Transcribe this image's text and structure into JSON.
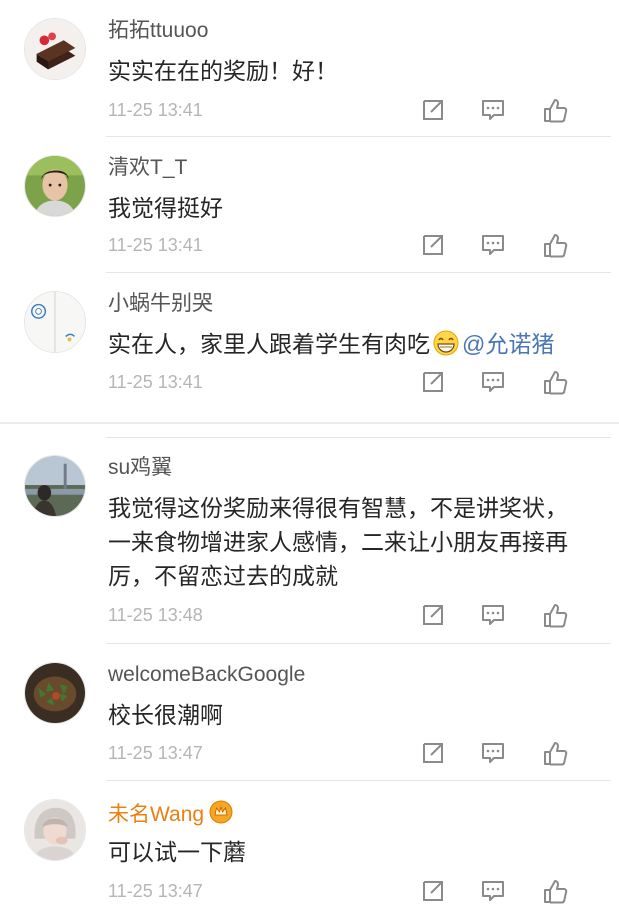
{
  "comments": [
    {
      "username": "拓拓ttuuoo",
      "text": "实实在在的奖励！好！",
      "time": "11-25 13:41",
      "avatar": "chocolate-cake-avatar"
    },
    {
      "username": "清欢T_T",
      "text": "我觉得挺好",
      "time": "11-25 13:41",
      "avatar": "boy-portrait-avatar"
    },
    {
      "username": "小蜗牛别哭",
      "text_before": "实在人，家里人跟着学生有肉吃",
      "mention": "@允诺猪",
      "time": "11-25 13:41",
      "avatar": "doraemon-sketch-avatar"
    },
    {
      "username": "su鸡翼",
      "text": "我觉得这份奖励来得很有智慧，不是讲奖状，一来食物增进家人感情，二来让小朋友再接再厉，不留恋过去的成就",
      "time": "11-25 13:48",
      "avatar": "landscape-person-avatar"
    },
    {
      "username": "welcomeBackGoogle",
      "text": "校长很潮啊",
      "time": "11-25 13:47",
      "avatar": "food-dish-avatar"
    },
    {
      "username": "未名Wang",
      "text": "可以试一下蘑",
      "time": "11-25 13:47",
      "avatar": "girl-portrait-avatar",
      "vip": true
    }
  ],
  "icons": {
    "share": "share-icon",
    "comment": "comment-icon",
    "like": "like-icon",
    "emoji": "grin-emoji-icon",
    "badge": "crown-badge-icon"
  },
  "colors": {
    "username": "#555555",
    "vip_username": "#ea8010",
    "text": "#262626",
    "time": "#b5b5b5",
    "mention": "#4a76b7",
    "icon": "#8a8a8a"
  }
}
